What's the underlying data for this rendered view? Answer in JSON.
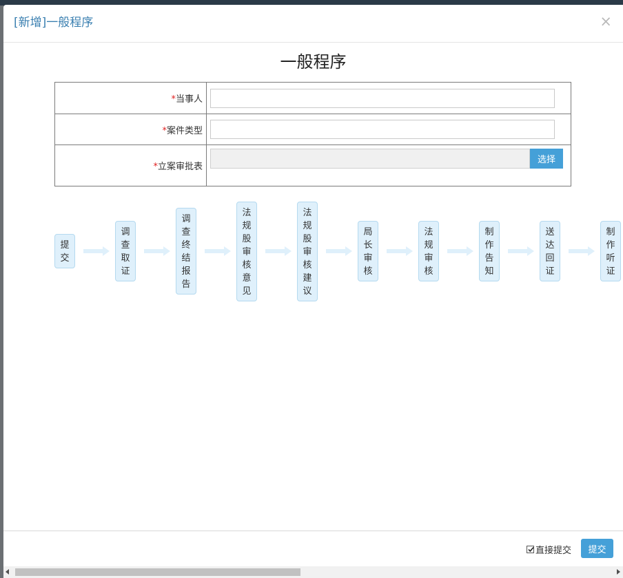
{
  "modal": {
    "title": "[新增]一般程序",
    "close_glyph": "×"
  },
  "form": {
    "heading": "一般程序",
    "required_mark": "*",
    "fields": [
      {
        "label": "当事人",
        "value": ""
      },
      {
        "label": "案件类型",
        "value": ""
      },
      {
        "label": "立案审批表",
        "value": "",
        "button_label": "选择"
      }
    ]
  },
  "flow": {
    "steps": [
      "提交",
      "调查取证",
      "调查终结报告",
      "法规股审核意见",
      "法规股审核建议",
      "局长审核",
      "法规审核",
      "制作告知",
      "送达回证",
      "制作听证"
    ],
    "step_color": "#dff0fb",
    "arrow_color": "#dff0fb"
  },
  "footer": {
    "direct_submit_label": "直接提交",
    "direct_submit_checked": true,
    "submit_label": "提交",
    "accent_color": "#45a0d8"
  }
}
